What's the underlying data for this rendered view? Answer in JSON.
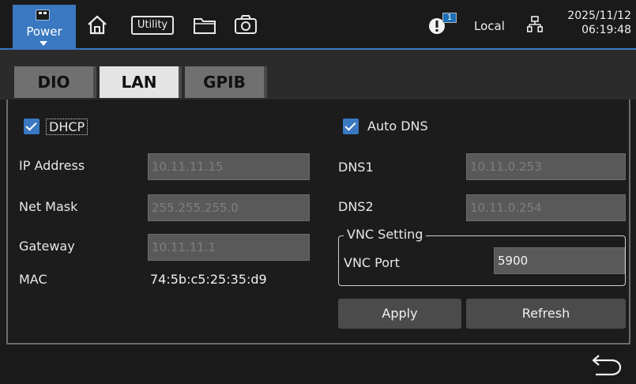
{
  "header": {
    "power_label": "Power",
    "utility_label": "Utility",
    "alert_count": "1",
    "mode": "Local",
    "date": "2025/11/12",
    "time": "06:19:48"
  },
  "tabs": [
    {
      "label": "DIO",
      "active": false
    },
    {
      "label": "LAN",
      "active": true
    },
    {
      "label": "GPIB",
      "active": false
    }
  ],
  "lan": {
    "dhcp_label": "DHCP",
    "dhcp_checked": true,
    "ip_label": "IP Address",
    "ip_value": "10.11.11.15",
    "mask_label": "Net Mask",
    "mask_value": "255.255.255.0",
    "gateway_label": "Gateway",
    "gateway_value": "10.11.11.1",
    "mac_label": "MAC",
    "mac_value": "74:5b:c5:25:35:d9",
    "auto_dns_label": "Auto DNS",
    "auto_dns_checked": true,
    "dns1_label": "DNS1",
    "dns1_value": "10.11.0.253",
    "dns2_label": "DNS2",
    "dns2_value": "10.11.0.254",
    "vnc_group_title": "VNC Setting",
    "vnc_port_label": "VNC Port",
    "vnc_port_value": "5900",
    "apply_label": "Apply",
    "refresh_label": "Refresh"
  },
  "colors": {
    "accent": "#3a78c2",
    "field_bg": "#595959",
    "active_tab": "#e4e4e4",
    "inactive_tab": "#707070"
  },
  "icons": [
    "device-icon",
    "home-icon",
    "folder-icon",
    "camera-icon",
    "alert-icon",
    "network-icon",
    "back-arrow-icon"
  ]
}
